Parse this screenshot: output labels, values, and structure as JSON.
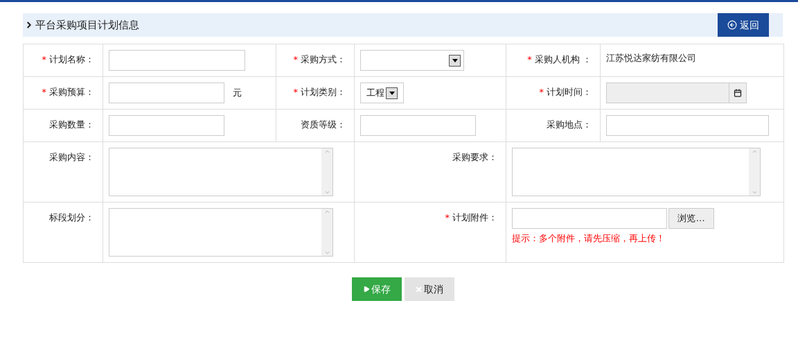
{
  "title": "平台采购项目计划信息",
  "back_button": "返回",
  "required_mark": "*",
  "rows": [
    [
      {
        "label": "计划名称：",
        "required": true,
        "kind": "text"
      },
      {
        "label": "采购方式：",
        "required": true,
        "kind": "select"
      },
      {
        "label": "采购人机构 ：",
        "required": true,
        "kind": "static",
        "value": "江苏悦达家纺有限公司"
      }
    ],
    [
      {
        "label": "采购预算：",
        "required": true,
        "kind": "text",
        "unit": "元"
      },
      {
        "label": "计划类别：",
        "required": true,
        "kind": "select",
        "value": "工程"
      },
      {
        "label": "计划时间：",
        "required": true,
        "kind": "date",
        "disabled": true
      }
    ],
    [
      {
        "label": "采购数量：",
        "required": false,
        "kind": "text"
      },
      {
        "label": "资质等级：",
        "required": false,
        "kind": "text"
      },
      {
        "label": "采购地点：",
        "required": false,
        "kind": "text"
      }
    ],
    [
      {
        "label": "采购内容：",
        "required": false,
        "kind": "textarea"
      },
      {
        "label": "采购要求：",
        "required": false,
        "kind": "textarea"
      }
    ],
    [
      {
        "label": "标段划分：",
        "required": false,
        "kind": "textarea"
      },
      {
        "label": "计划附件：",
        "required": true,
        "kind": "file",
        "button": "浏览...",
        "hint": "提示：多个附件，请先压缩，再上传！"
      }
    ]
  ],
  "actions": [
    {
      "kind": "save",
      "label": "保存"
    },
    {
      "kind": "cancel",
      "label": "取消"
    }
  ]
}
